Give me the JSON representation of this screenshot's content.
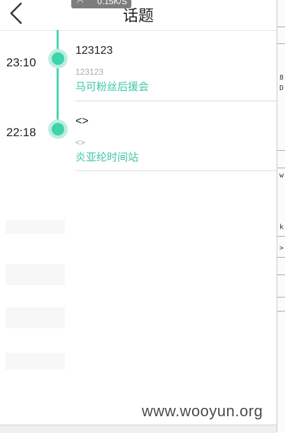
{
  "header": {
    "title": "话题",
    "back_icon": "chevron-left-icon",
    "network_speed": "0.15K/S"
  },
  "timeline": [
    {
      "time": "23:10",
      "title": "123123",
      "subtitle": "123123",
      "group": "马可粉丝后援会"
    },
    {
      "time": "22:18",
      "title": "<>",
      "subtitle": "<>",
      "group": "炎亚纶时间站"
    }
  ],
  "right_panel": {
    "texts": [
      "8",
      "D:",
      "w",
      "k",
      ">"
    ]
  },
  "watermark": "www.wooyun.org",
  "colors": {
    "accent": "#3cc6a4",
    "timeline_line": "#46d6b2",
    "dot": "#3ed3ab"
  }
}
